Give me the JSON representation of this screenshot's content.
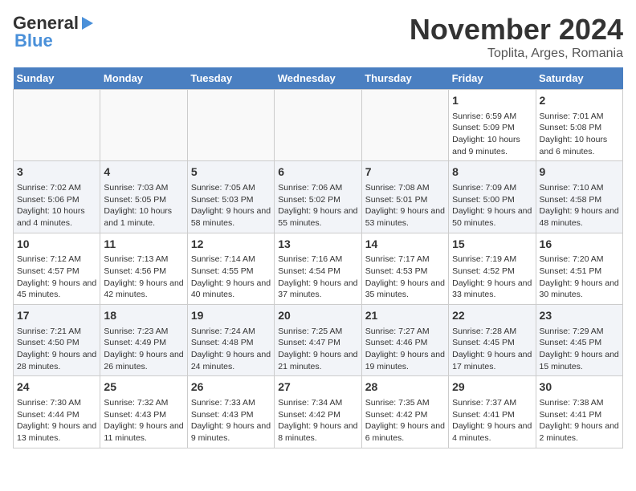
{
  "header": {
    "logo_line1": "General",
    "logo_line2": "Blue",
    "month": "November 2024",
    "location": "Toplita, Arges, Romania"
  },
  "weekdays": [
    "Sunday",
    "Monday",
    "Tuesday",
    "Wednesday",
    "Thursday",
    "Friday",
    "Saturday"
  ],
  "weeks": [
    [
      {
        "day": "",
        "info": ""
      },
      {
        "day": "",
        "info": ""
      },
      {
        "day": "",
        "info": ""
      },
      {
        "day": "",
        "info": ""
      },
      {
        "day": "",
        "info": ""
      },
      {
        "day": "1",
        "info": "Sunrise: 6:59 AM\nSunset: 5:09 PM\nDaylight: 10 hours and 9 minutes."
      },
      {
        "day": "2",
        "info": "Sunrise: 7:01 AM\nSunset: 5:08 PM\nDaylight: 10 hours and 6 minutes."
      }
    ],
    [
      {
        "day": "3",
        "info": "Sunrise: 7:02 AM\nSunset: 5:06 PM\nDaylight: 10 hours and 4 minutes."
      },
      {
        "day": "4",
        "info": "Sunrise: 7:03 AM\nSunset: 5:05 PM\nDaylight: 10 hours and 1 minute."
      },
      {
        "day": "5",
        "info": "Sunrise: 7:05 AM\nSunset: 5:03 PM\nDaylight: 9 hours and 58 minutes."
      },
      {
        "day": "6",
        "info": "Sunrise: 7:06 AM\nSunset: 5:02 PM\nDaylight: 9 hours and 55 minutes."
      },
      {
        "day": "7",
        "info": "Sunrise: 7:08 AM\nSunset: 5:01 PM\nDaylight: 9 hours and 53 minutes."
      },
      {
        "day": "8",
        "info": "Sunrise: 7:09 AM\nSunset: 5:00 PM\nDaylight: 9 hours and 50 minutes."
      },
      {
        "day": "9",
        "info": "Sunrise: 7:10 AM\nSunset: 4:58 PM\nDaylight: 9 hours and 48 minutes."
      }
    ],
    [
      {
        "day": "10",
        "info": "Sunrise: 7:12 AM\nSunset: 4:57 PM\nDaylight: 9 hours and 45 minutes."
      },
      {
        "day": "11",
        "info": "Sunrise: 7:13 AM\nSunset: 4:56 PM\nDaylight: 9 hours and 42 minutes."
      },
      {
        "day": "12",
        "info": "Sunrise: 7:14 AM\nSunset: 4:55 PM\nDaylight: 9 hours and 40 minutes."
      },
      {
        "day": "13",
        "info": "Sunrise: 7:16 AM\nSunset: 4:54 PM\nDaylight: 9 hours and 37 minutes."
      },
      {
        "day": "14",
        "info": "Sunrise: 7:17 AM\nSunset: 4:53 PM\nDaylight: 9 hours and 35 minutes."
      },
      {
        "day": "15",
        "info": "Sunrise: 7:19 AM\nSunset: 4:52 PM\nDaylight: 9 hours and 33 minutes."
      },
      {
        "day": "16",
        "info": "Sunrise: 7:20 AM\nSunset: 4:51 PM\nDaylight: 9 hours and 30 minutes."
      }
    ],
    [
      {
        "day": "17",
        "info": "Sunrise: 7:21 AM\nSunset: 4:50 PM\nDaylight: 9 hours and 28 minutes."
      },
      {
        "day": "18",
        "info": "Sunrise: 7:23 AM\nSunset: 4:49 PM\nDaylight: 9 hours and 26 minutes."
      },
      {
        "day": "19",
        "info": "Sunrise: 7:24 AM\nSunset: 4:48 PM\nDaylight: 9 hours and 24 minutes."
      },
      {
        "day": "20",
        "info": "Sunrise: 7:25 AM\nSunset: 4:47 PM\nDaylight: 9 hours and 21 minutes."
      },
      {
        "day": "21",
        "info": "Sunrise: 7:27 AM\nSunset: 4:46 PM\nDaylight: 9 hours and 19 minutes."
      },
      {
        "day": "22",
        "info": "Sunrise: 7:28 AM\nSunset: 4:45 PM\nDaylight: 9 hours and 17 minutes."
      },
      {
        "day": "23",
        "info": "Sunrise: 7:29 AM\nSunset: 4:45 PM\nDaylight: 9 hours and 15 minutes."
      }
    ],
    [
      {
        "day": "24",
        "info": "Sunrise: 7:30 AM\nSunset: 4:44 PM\nDaylight: 9 hours and 13 minutes."
      },
      {
        "day": "25",
        "info": "Sunrise: 7:32 AM\nSunset: 4:43 PM\nDaylight: 9 hours and 11 minutes."
      },
      {
        "day": "26",
        "info": "Sunrise: 7:33 AM\nSunset: 4:43 PM\nDaylight: 9 hours and 9 minutes."
      },
      {
        "day": "27",
        "info": "Sunrise: 7:34 AM\nSunset: 4:42 PM\nDaylight: 9 hours and 8 minutes."
      },
      {
        "day": "28",
        "info": "Sunrise: 7:35 AM\nSunset: 4:42 PM\nDaylight: 9 hours and 6 minutes."
      },
      {
        "day": "29",
        "info": "Sunrise: 7:37 AM\nSunset: 4:41 PM\nDaylight: 9 hours and 4 minutes."
      },
      {
        "day": "30",
        "info": "Sunrise: 7:38 AM\nSunset: 4:41 PM\nDaylight: 9 hours and 2 minutes."
      }
    ]
  ]
}
